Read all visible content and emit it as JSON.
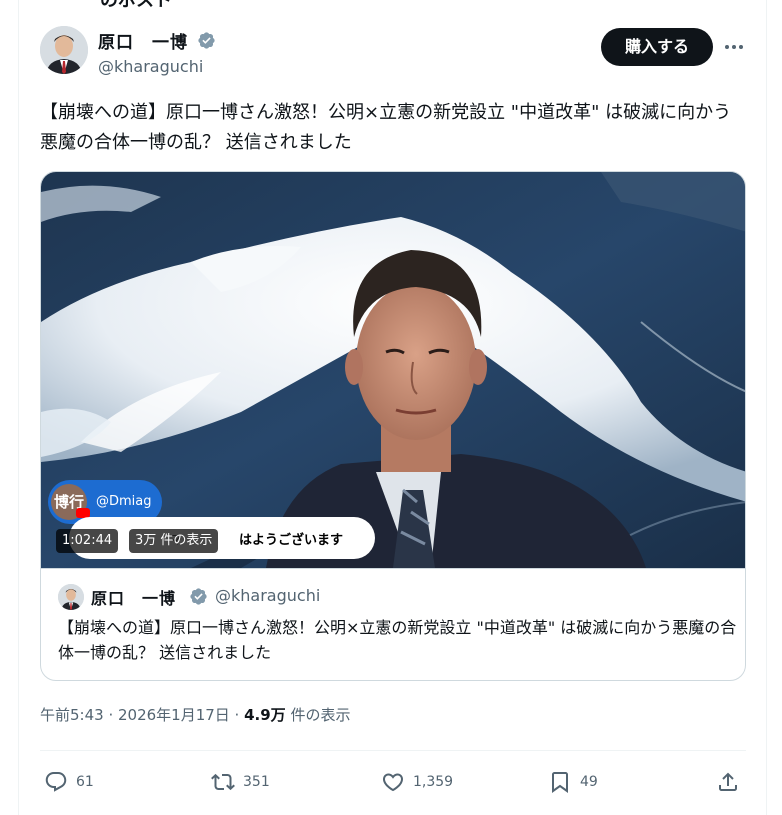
{
  "header": {
    "cut_title": "のポスト"
  },
  "author": {
    "display_name": "原口　一博",
    "handle": "@kharaguchi",
    "verified_icon": "verified-badge-icon"
  },
  "actions_top": {
    "buy_label": "購入する",
    "more_icon": "more-icon"
  },
  "tweet": {
    "text": "【崩壊への道】原口一博さん激怒！公明×立憲の新党設立 \"中道改革\" は破滅に向かう悪魔の合体一博の乱？ 送信されました"
  },
  "media": {
    "live_avatar_label": "博行",
    "live_handle": "@Dmiag",
    "chat_faint": "マ",
    "chat_text": "はようございます",
    "duration": "1:02:44",
    "views": "3万 件の表示"
  },
  "quoted": {
    "display_name": "原口　一博",
    "handle": "@kharaguchi",
    "text": "【崩壊への道】原口一博さん激怒！公明×立憲の新党設立 \"中道改革\" は破滅に向かう悪魔の合体一博の乱？ 送信されました"
  },
  "meta": {
    "time_date": "午前5:43 · 2026年1月17日 · ",
    "views_count": "4.9万",
    "views_label": " 件の表示"
  },
  "engagement": {
    "replies": "61",
    "reposts": "351",
    "likes": "1,359",
    "bookmarks": "49"
  },
  "colors": {
    "text_primary": "#0f1419",
    "text_secondary": "#536471",
    "border": "#cfd9de",
    "button_dark": "#0f1419"
  }
}
